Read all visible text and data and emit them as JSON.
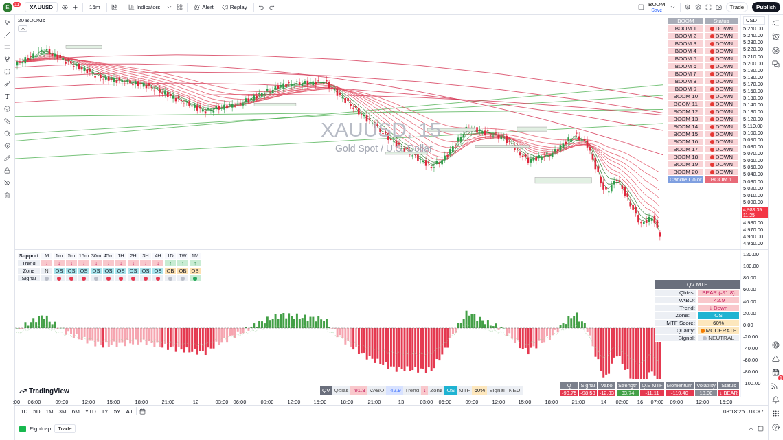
{
  "toolbar": {
    "avatar_initial": "E",
    "notification_count": "11",
    "symbol": "XAUUSD",
    "interval": "15m",
    "indicators": "Indicators",
    "alert": "Alert",
    "replay": "Replay",
    "layout_name": "BOOM",
    "layout_status": "Save",
    "trade": "Trade",
    "publish": "Publish"
  },
  "chart": {
    "legend": "20 BOOMs",
    "watermark_symbol": "XAUUSD, 15",
    "watermark_description": "Gold Spot / U.S. Dollar",
    "currency": "USD",
    "price_axis": [
      {
        "kind": "tick",
        "text": "5,250.00"
      },
      {
        "kind": "tick",
        "text": "5,240.00"
      },
      {
        "kind": "tick",
        "text": "5,230.00"
      },
      {
        "kind": "tick",
        "text": "5,220.00"
      },
      {
        "kind": "tick",
        "text": "5,210.00"
      },
      {
        "kind": "tick",
        "text": "5,200.00"
      },
      {
        "kind": "tick",
        "text": "5,190.00"
      },
      {
        "kind": "tick",
        "text": "5,180.00"
      },
      {
        "kind": "tick",
        "text": "5,170.00"
      },
      {
        "kind": "tick",
        "text": "5,160.00"
      },
      {
        "kind": "tick",
        "text": "5,150.00"
      },
      {
        "kind": "tick",
        "text": "5,140.00"
      },
      {
        "kind": "tick",
        "text": "5,130.00"
      },
      {
        "kind": "tick",
        "text": "5,120.00"
      },
      {
        "kind": "tick",
        "text": "5,110.00"
      },
      {
        "kind": "tick",
        "text": "5,100.00"
      },
      {
        "kind": "tick",
        "text": "5,090.00"
      },
      {
        "kind": "tick",
        "text": "5,080.00"
      },
      {
        "kind": "tick",
        "text": "5,070.00"
      },
      {
        "kind": "tick",
        "text": "5,060.00"
      },
      {
        "kind": "tick",
        "text": "5,050.00"
      },
      {
        "kind": "tick",
        "text": "5,040.00"
      },
      {
        "kind": "tick",
        "text": "5,030.00"
      },
      {
        "kind": "tick",
        "text": "5,020.00"
      },
      {
        "kind": "tick",
        "text": "5,010.00"
      },
      {
        "kind": "tick",
        "text": "5,000.00"
      },
      {
        "kind": "last",
        "text": "4,988.39",
        "countdown": "11:25"
      },
      {
        "kind": "tick",
        "text": "4,980.00"
      },
      {
        "kind": "tick",
        "text": "4,970.00"
      },
      {
        "kind": "tick",
        "text": "4,960.00"
      },
      {
        "kind": "tick",
        "text": "4,950.00"
      }
    ],
    "branding": "TradingView"
  },
  "boom_table": {
    "columns": [
      "BOOM",
      "Status"
    ],
    "rows": [
      {
        "name": "BOOM 1",
        "status": "DOWN"
      },
      {
        "name": "BOOM 2",
        "status": "DOWN"
      },
      {
        "name": "BOOM 3",
        "status": "DOWN"
      },
      {
        "name": "BOOM 4",
        "status": "DOWN"
      },
      {
        "name": "BOOM 5",
        "status": "DOWN"
      },
      {
        "name": "BOOM 6",
        "status": "DOWN"
      },
      {
        "name": "BOOM 7",
        "status": "DOWN"
      },
      {
        "name": "BOOM 8",
        "status": "DOWN"
      },
      {
        "name": "BOOM 9",
        "status": "DOWN"
      },
      {
        "name": "BOOM 10",
        "status": "DOWN"
      },
      {
        "name": "BOOM 11",
        "status": "DOWN"
      },
      {
        "name": "BOOM 12",
        "status": "DOWN"
      },
      {
        "name": "BOOM 13",
        "status": "DOWN"
      },
      {
        "name": "BOOM 14",
        "status": "DOWN"
      },
      {
        "name": "BOOM 15",
        "status": "DOWN"
      },
      {
        "name": "BOOM 16",
        "status": "DOWN"
      },
      {
        "name": "BOOM 17",
        "status": "DOWN"
      },
      {
        "name": "BOOM 18",
        "status": "DOWN"
      },
      {
        "name": "BOOM 19",
        "status": "DOWN"
      },
      {
        "name": "BOOM 20",
        "status": "DOWN"
      }
    ],
    "footer_label": "Candle Color",
    "footer_value": "BOOM 1"
  },
  "support_table": {
    "title": "Support",
    "columns": [
      "M",
      "1m",
      "5m",
      "15m",
      "30m",
      "45m",
      "1H",
      "2H",
      "3H",
      "4H",
      "1D",
      "1W",
      "1M"
    ],
    "rows": [
      {
        "label": "Trend",
        "cells": [
          {
            "text": "↓",
            "kind": "bear"
          },
          {
            "text": "↓",
            "kind": "bear"
          },
          {
            "text": "↓",
            "kind": "bear"
          },
          {
            "text": "↓",
            "kind": "bear"
          },
          {
            "text": "↓",
            "kind": "bear"
          },
          {
            "text": "↓",
            "kind": "bear"
          },
          {
            "text": "↓",
            "kind": "bear"
          },
          {
            "text": "↓",
            "kind": "bear"
          },
          {
            "text": "↓",
            "kind": "bear"
          },
          {
            "text": "↓",
            "kind": "bear"
          },
          {
            "text": "↑",
            "kind": "bull"
          },
          {
            "text": "↑",
            "kind": "bull"
          },
          {
            "text": "↑",
            "kind": "bull"
          }
        ]
      },
      {
        "label": "Zone",
        "cells": [
          {
            "text": "N",
            "kind": "neutral"
          },
          {
            "text": "OS",
            "kind": "os"
          },
          {
            "text": "OS",
            "kind": "os"
          },
          {
            "text": "OS",
            "kind": "os"
          },
          {
            "text": "OS",
            "kind": "os"
          },
          {
            "text": "OS",
            "kind": "os"
          },
          {
            "text": "OS",
            "kind": "os"
          },
          {
            "text": "OS",
            "kind": "os"
          },
          {
            "text": "OS",
            "kind": "os"
          },
          {
            "text": "OS",
            "kind": "os"
          },
          {
            "text": "OB",
            "kind": "ob"
          },
          {
            "text": "OB",
            "kind": "ob"
          },
          {
            "text": "OB",
            "kind": "ob"
          }
        ]
      },
      {
        "label": "Signal",
        "cells": [
          {
            "kind": "neutral"
          },
          {
            "kind": "bear"
          },
          {
            "kind": "bear"
          },
          {
            "kind": "bear"
          },
          {
            "kind": "neutral"
          },
          {
            "kind": "bear"
          },
          {
            "kind": "bear"
          },
          {
            "kind": "bear"
          },
          {
            "kind": "bear"
          },
          {
            "kind": "bear"
          },
          {
            "kind": "neutral"
          },
          {
            "kind": "neutral"
          },
          {
            "kind": "bull"
          }
        ]
      }
    ]
  },
  "oscillator": {
    "ticks": [
      "120.00",
      "100.00",
      "80.00",
      "60.00",
      "40.00",
      "20.00",
      "0.00",
      "-20.00",
      "-40.00",
      "-60.00",
      "-80.00",
      "-100.00"
    ]
  },
  "qv_table": {
    "title": "QV MTF",
    "rows": [
      {
        "label": "Qbias:",
        "value": "BEAR (-91.8)",
        "kind": "bear"
      },
      {
        "label": "VABO:",
        "value": "-42.9",
        "kind": "bear"
      },
      {
        "label": "Trend:",
        "value": "↓ Down",
        "kind": "bear"
      },
      {
        "label": "—Zone:—",
        "value": "OS",
        "kind": "zone"
      },
      {
        "label": "MTF Score:",
        "value": "60%",
        "kind": "score"
      },
      {
        "label": "Quality:",
        "value": "MODERATE",
        "kind": "quality"
      },
      {
        "label": "Signal:",
        "value": "NEUTRAL",
        "kind": "neutral"
      }
    ]
  },
  "qv_strip": [
    {
      "text": "QV",
      "kind": "badge"
    },
    {
      "text": "Qbias",
      "kind": "label"
    },
    {
      "text": "-91.8",
      "kind": "bear"
    },
    {
      "text": "VABO",
      "kind": "label"
    },
    {
      "text": "-42.9",
      "kind": "cool"
    },
    {
      "text": "Trend",
      "kind": "label"
    },
    {
      "text": "↓",
      "kind": "bear"
    },
    {
      "text": "Zone",
      "kind": "label"
    },
    {
      "text": "OS",
      "kind": "zone"
    },
    {
      "text": "MTF",
      "kind": "label"
    },
    {
      "text": "60%",
      "kind": "score"
    },
    {
      "text": "Signal",
      "kind": "label"
    },
    {
      "text": "NEU",
      "kind": "neutral"
    }
  ],
  "stats_table": {
    "columns": [
      "Q",
      "Signal",
      "Vabo",
      "Strength",
      "Q.E MTF",
      "Momentum",
      "Volatility",
      "Status"
    ],
    "values": [
      {
        "text": "-93.75",
        "kind": "bear"
      },
      {
        "text": "-98.58",
        "kind": "bear"
      },
      {
        "text": "-12.83",
        "kind": "bear"
      },
      {
        "text": "83.74",
        "kind": "bull"
      },
      {
        "text": "-11.11",
        "kind": "bear"
      },
      {
        "text": "-119.40",
        "kind": "bear"
      },
      {
        "text": "18.00",
        "kind": "neutral"
      },
      {
        "text": "↓ BEAR",
        "kind": "bear"
      }
    ]
  },
  "time_axis": [
    ":00",
    "06:00",
    "09:00",
    "12:00",
    "15:00",
    "18:00",
    "21:00",
    "12",
    "03:00",
    "06:00",
    "09:00",
    "12:00",
    "15:00",
    "18:00",
    "21:00",
    "13",
    "03:00",
    "06:00",
    "09:00",
    "12:00",
    "15:00",
    "18:00",
    "21:00",
    "14",
    "02:00",
    "16",
    "07:00",
    "09:00",
    "12:00",
    "15:00"
  ],
  "ranges": [
    "1D",
    "5D",
    "1M",
    "3M",
    "6M",
    "YTD",
    "1Y",
    "5Y",
    "All"
  ],
  "clock": "08:18:25 UTC+7",
  "footer": {
    "broker": "Eightcap",
    "trade": "Trade"
  },
  "notifications_badge": "1"
}
